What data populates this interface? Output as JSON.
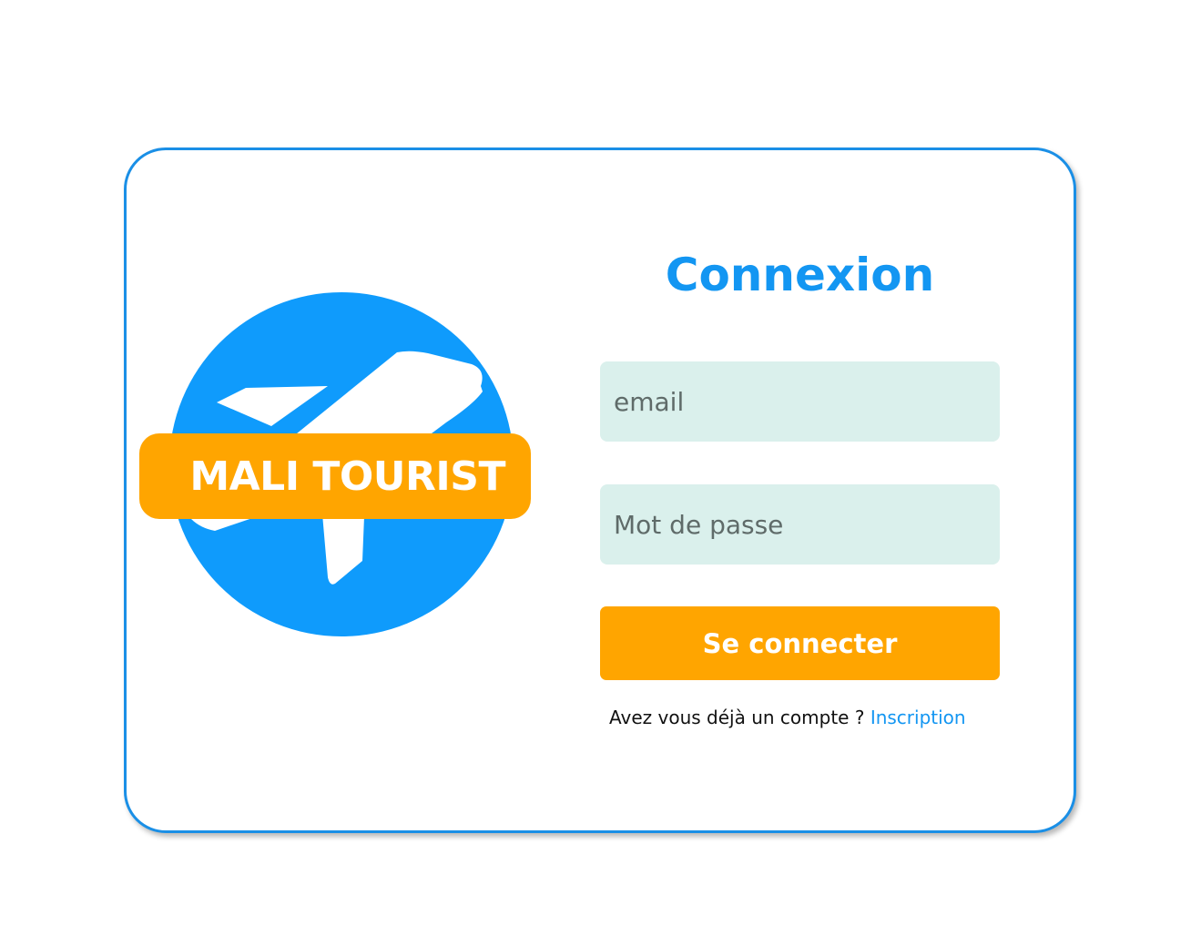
{
  "brand": {
    "name": "MALI TOURIST",
    "logo_icon": "airplane-icon",
    "colors": {
      "circle": "#0f9bfc",
      "banner": "#ffa500",
      "plane": "#ffffff"
    }
  },
  "login_form": {
    "title": "Connexion",
    "email_placeholder": "email",
    "password_placeholder": "Mot de passe",
    "submit_label": "Se connecter",
    "register_prompt": "Avez vous déjà un compte ?",
    "register_link": "Inscription"
  },
  "colors": {
    "accent": "#1396f2",
    "button": "#ffa500",
    "input_background": "#daf0ec",
    "card_border": "#1a8fe6"
  }
}
